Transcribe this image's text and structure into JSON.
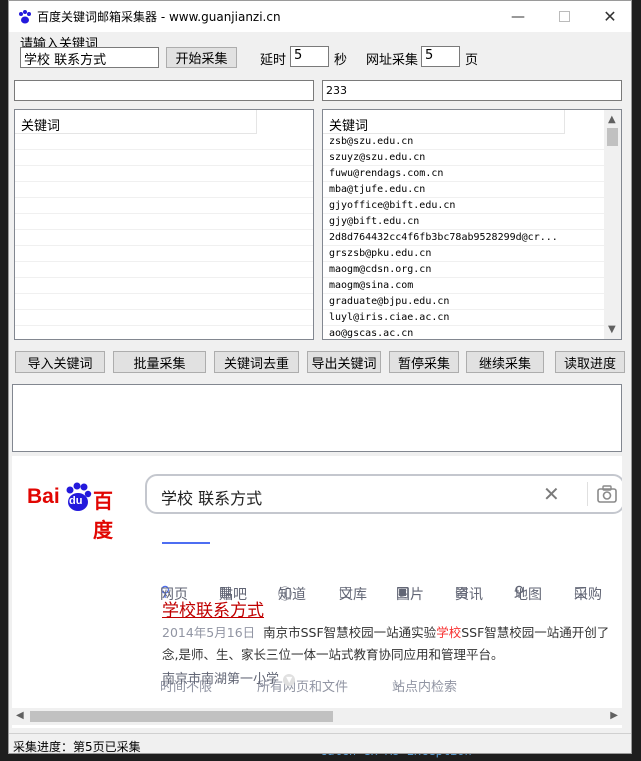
{
  "window": {
    "title": "百度关键词邮箱采集器 - www.guanjianzi.cn"
  },
  "form": {
    "keyword_label": "请输入关键词",
    "keyword_value": "学校 联系方式",
    "start_button": "开始采集",
    "delay_label": "延时",
    "delay_value": "5",
    "delay_unit": "秒",
    "pages_label": "网址采集",
    "pages_value": "5",
    "pages_unit": "页"
  },
  "inputs": {
    "left_value": "",
    "right_value": "233"
  },
  "left_list": {
    "header": "关键词",
    "rows": []
  },
  "right_list": {
    "header": "关键词",
    "rows": [
      "zsb@szu.edu.cn",
      "szuyz@szu.edu.cn",
      "fuwu@rendags.com.cn",
      "mba@tjufe.edu.cn",
      "gjyoffice@bift.edu.cn",
      "gjy@bift.edu.cn",
      "2d8d764432cc4f6fb3bc78ab9528299d@cr...",
      "grszsb@pku.edu.cn",
      "maogm@cdsn.org.cn",
      "maogm@sina.com",
      "graduate@bjpu.edu.cn",
      "luyl@iris.ciae.ac.cn",
      "ao@gscas.ac.cn"
    ]
  },
  "buttons": {
    "import": "导入关键词",
    "batch": "批量采集",
    "dedupe": "关键词去重",
    "export": "导出关键词",
    "pause": "暂停采集",
    "resume": "继续采集",
    "load_progress": "读取进度"
  },
  "browser": {
    "logo_bai": "Bai",
    "logo_du": "du",
    "logo_cn": "百度",
    "search_query": "学校 联系方式",
    "tabs": [
      "网页",
      "贴吧",
      "知道",
      "文库",
      "图片",
      "资讯",
      "地图",
      "采购"
    ],
    "filters": [
      "时间不限",
      "所有网页和文件",
      "站点内检索"
    ],
    "result": {
      "title": "学校联系方式",
      "date": "2014年5月16日",
      "snippet_line1_a": "南京市SSF智慧校园一站通实验",
      "snippet_line1_hl": "学校",
      "snippet_line1_b": "SSF智慧校园一站通开创了",
      "snippet_line2": "念,是师、生、家长三位一体一站式教育协同应用和管理平台。",
      "source": "南京市南湖第一小学"
    }
  },
  "status": {
    "text": "采集进度：第5页已采集"
  },
  "background": {
    "bottom_code": "catch ex As Exception"
  },
  "colors": {
    "baidu_red": "#e10602",
    "baidu_blue": "#2319dc",
    "link_red": "#c00000",
    "link_blue": "#2440b3"
  }
}
